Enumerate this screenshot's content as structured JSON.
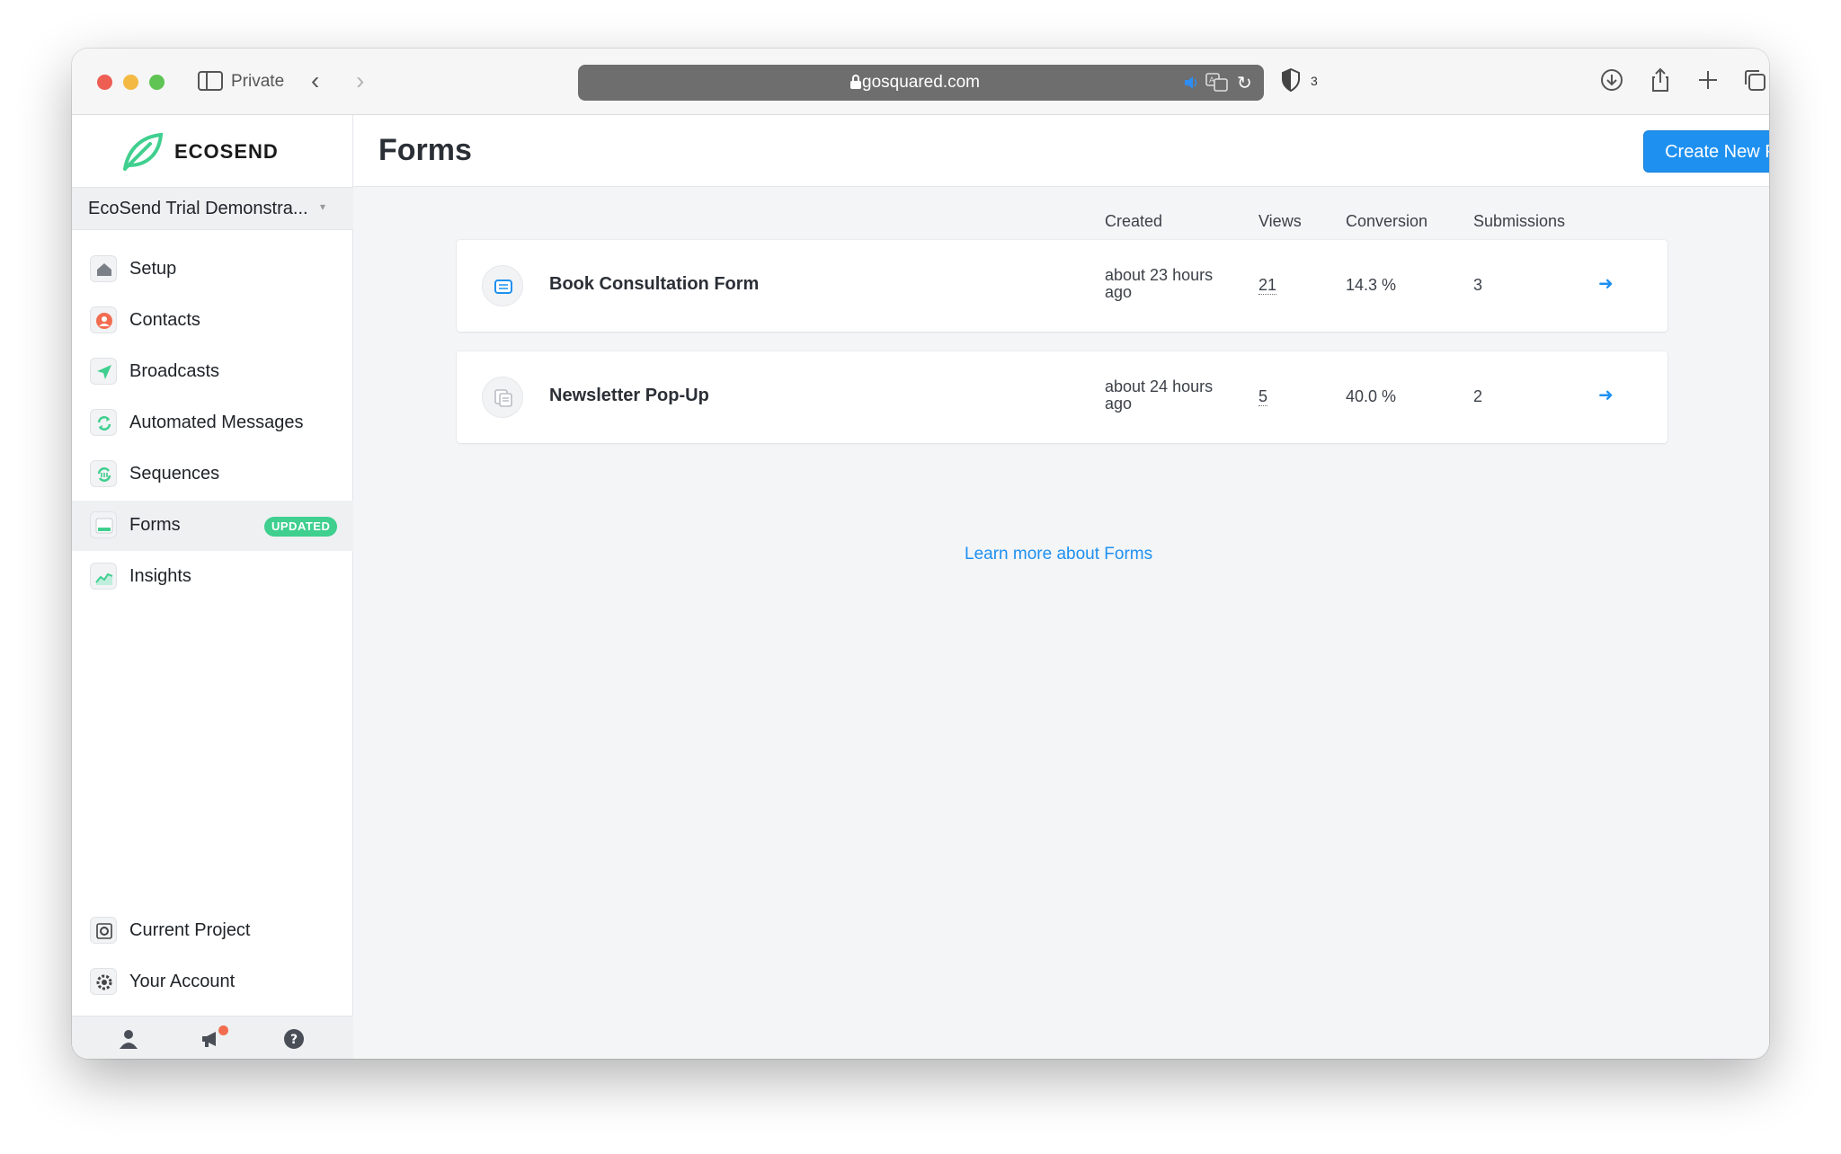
{
  "browser": {
    "private_label": "Private",
    "url": "gosquared.com",
    "shield_count": "3"
  },
  "sidebar": {
    "logo_text": "ECOSEND",
    "project_name": "EcoSend Trial Demonstra...",
    "items": [
      {
        "label": "Setup",
        "icon": "home-icon"
      },
      {
        "label": "Contacts",
        "icon": "contact-icon"
      },
      {
        "label": "Broadcasts",
        "icon": "send-icon"
      },
      {
        "label": "Automated Messages",
        "icon": "refresh-icon"
      },
      {
        "label": "Sequences",
        "icon": "sequence-icon"
      },
      {
        "label": "Forms",
        "icon": "form-icon",
        "badge": "UPDATED",
        "active": true
      },
      {
        "label": "Insights",
        "icon": "chart-icon"
      }
    ],
    "bottom_items": [
      {
        "label": "Current Project",
        "icon": "project-icon"
      },
      {
        "label": "Your Account",
        "icon": "account-gear-icon"
      }
    ],
    "footer_icons": [
      "user-icon",
      "megaphone-icon",
      "help-icon"
    ]
  },
  "main": {
    "title": "Forms",
    "create_button": "Create New Form",
    "columns": [
      "Created",
      "Views",
      "Conversion",
      "Submissions"
    ],
    "rows": [
      {
        "name": "Book Consultation Form",
        "created": "about 23 hours ago",
        "views": "21",
        "conversion": "14.3 %",
        "submissions": "3",
        "icon": "embedded-form-icon"
      },
      {
        "name": "Newsletter Pop-Up",
        "created": "about 24 hours ago",
        "views": "5",
        "conversion": "40.0 %",
        "submissions": "2",
        "icon": "popup-form-icon"
      }
    ],
    "learn_more": "Learn more about Forms"
  },
  "colors": {
    "accent": "#1e90f0",
    "badge": "#3fcf8e",
    "brand": "#3fcf8e"
  }
}
